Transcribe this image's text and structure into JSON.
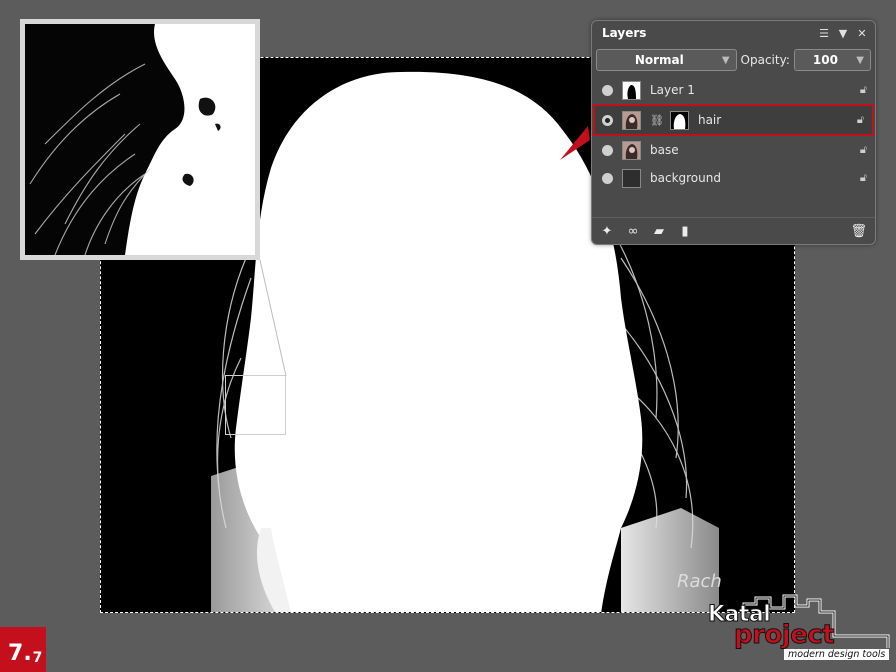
{
  "layers_panel": {
    "title": "Layers",
    "blend_mode": "Normal",
    "opacity_label": "Opacity:",
    "opacity_value": "100",
    "layers": [
      {
        "name": "Layer 1",
        "selected": false
      },
      {
        "name": "hair",
        "selected": true
      },
      {
        "name": "base",
        "selected": false
      },
      {
        "name": "background",
        "selected": false
      }
    ],
    "footer_icons": [
      "effects-icon",
      "mask-icon",
      "folder-icon",
      "new-layer-icon",
      "trash-icon"
    ]
  },
  "step_badge": {
    "major": "7",
    "minor": "7"
  },
  "watermark_text": "Rach",
  "logo": {
    "line1": "Katal",
    "line2": "project",
    "tagline": "modern design tools"
  },
  "colors": {
    "accent": "#c4101c",
    "panel_bg": "#4a4a4a",
    "workspace": "#5c5c5c"
  }
}
